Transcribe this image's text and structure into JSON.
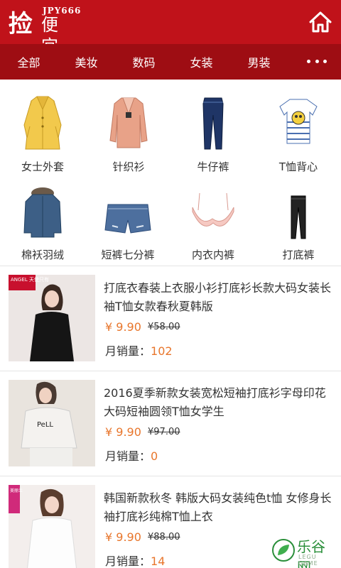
{
  "header": {
    "logo_char": "捡",
    "logo_en": "JPY666",
    "logo_cn": "便宜",
    "home_icon": "home-icon"
  },
  "nav": {
    "items": [
      "全部",
      "美妆",
      "数码",
      "女装",
      "男装"
    ],
    "more_icon": "more-dots-icon"
  },
  "categories": [
    {
      "label": "女士外套",
      "icon": "coat-icon"
    },
    {
      "label": "针织衫",
      "icon": "cardigan-icon"
    },
    {
      "label": "牛仔裤",
      "icon": "jeans-icon"
    },
    {
      "label": "T恤背心",
      "icon": "tshirt-icon"
    },
    {
      "label": "棉袄羽绒",
      "icon": "parka-icon"
    },
    {
      "label": "短裤七分裤",
      "icon": "shorts-icon"
    },
    {
      "label": "内衣内裤",
      "icon": "bra-icon"
    },
    {
      "label": "打底裤",
      "icon": "leggings-icon"
    }
  ],
  "products": [
    {
      "title": "打底衣春装上衣服小衫打底衫长款大码女装长袖T恤女款春秋夏韩版",
      "price": "¥ 9.90",
      "old_price": "¥58.00",
      "sales_label": "月销量：",
      "sales": "102",
      "badge": "ANGEL 天使只有"
    },
    {
      "title": "2016夏季新款女装宽松短袖打底衫字母印花大码短袖圆领T恤女学生",
      "price": "¥ 9.90",
      "old_price": "¥97.00",
      "sales_label": "月销量：",
      "sales": "0",
      "badge": ""
    },
    {
      "title": "韩国新款秋冬 韩版大码女装纯色t恤 女修身长袖打底衫纯棉T恤上衣",
      "price": "¥ 9.90",
      "old_price": "¥88.00",
      "sales_label": "月销量：",
      "sales": "14",
      "badge": "美丽兰"
    }
  ],
  "watermark": {
    "text": "乐谷网",
    "sub": "LEGU GAME"
  },
  "colors": {
    "header_red": "#c0121a",
    "nav_red": "#9e0d13",
    "price_orange": "#e8762c"
  }
}
